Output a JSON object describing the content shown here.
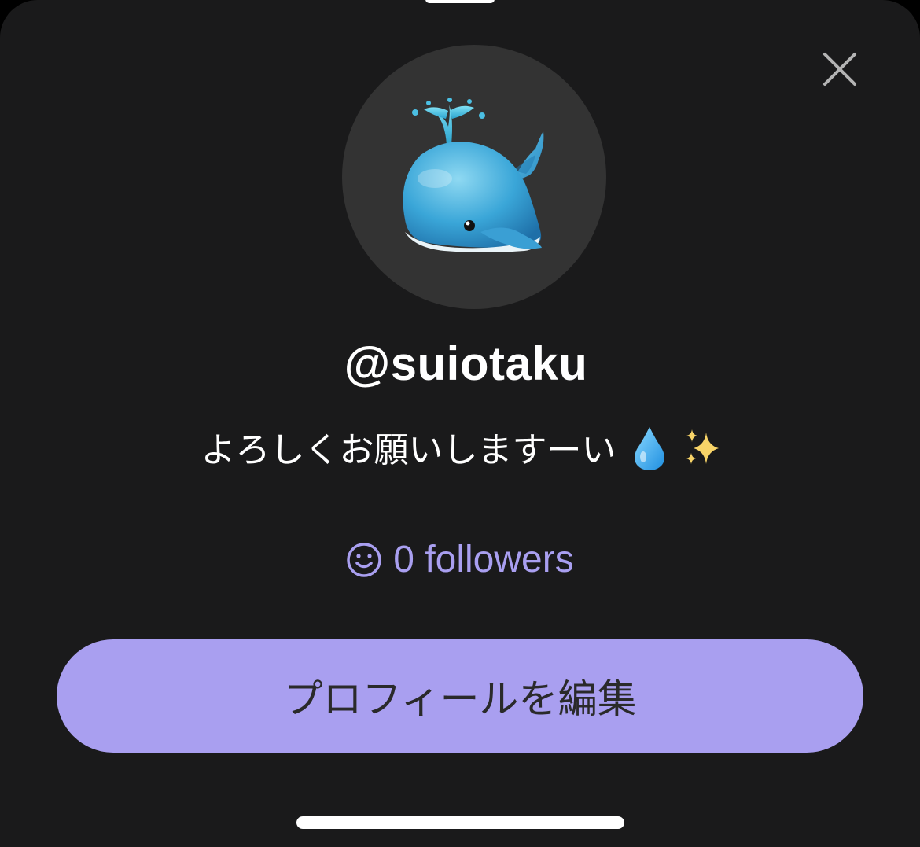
{
  "profile": {
    "username": "@suiotaku",
    "bio_text": "よろしくお願いしますーい",
    "bio_emojis": [
      "droplet",
      "sparkles"
    ],
    "avatar_icon": "spouting-whale-icon",
    "followers_text": "0 followers"
  },
  "actions": {
    "edit_profile_label": "プロフィールを編集",
    "close_icon": "close-icon"
  },
  "colors": {
    "background": "#1a1a1b",
    "avatar_bg": "#333333",
    "accent": "#a99ff0",
    "text": "#ffffff"
  }
}
